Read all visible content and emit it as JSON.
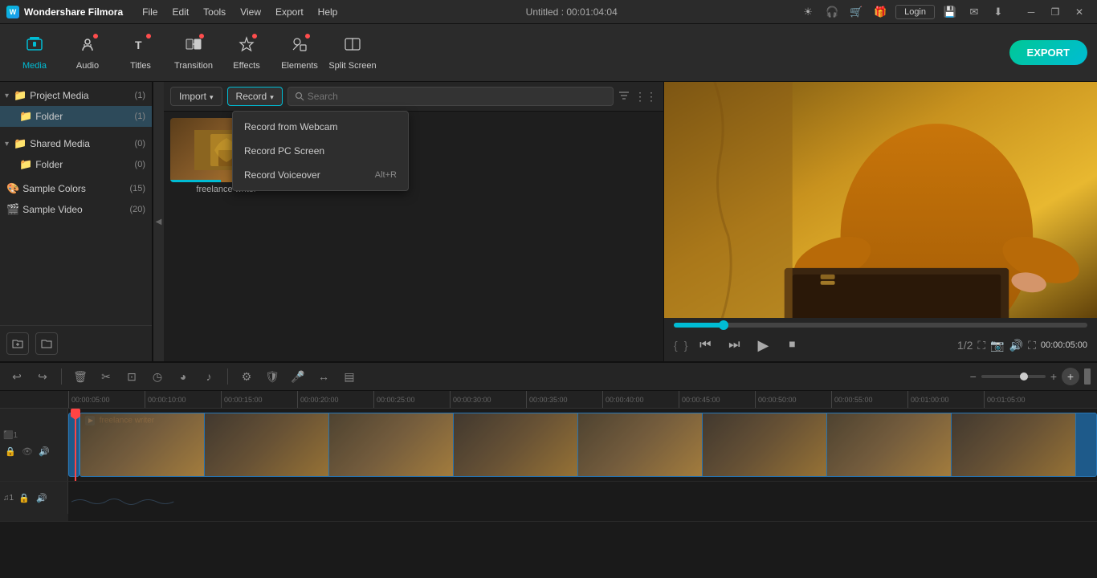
{
  "app": {
    "name": "Wondershare Filmora",
    "title": "Untitled : 00:01:04:04"
  },
  "menu": {
    "items": [
      "File",
      "Edit",
      "Tools",
      "View",
      "Export",
      "Help"
    ]
  },
  "toolbar": {
    "items": [
      {
        "id": "media",
        "label": "Media",
        "icon": "🎞",
        "active": true,
        "badge": false
      },
      {
        "id": "audio",
        "label": "Audio",
        "icon": "🎵",
        "active": false,
        "badge": true
      },
      {
        "id": "titles",
        "label": "Titles",
        "icon": "T",
        "active": false,
        "badge": true
      },
      {
        "id": "transition",
        "label": "Transition",
        "icon": "⧉",
        "active": false,
        "badge": true
      },
      {
        "id": "effects",
        "label": "Effects",
        "icon": "✦",
        "active": false,
        "badge": true
      },
      {
        "id": "elements",
        "label": "Elements",
        "icon": "◈",
        "active": false,
        "badge": true
      },
      {
        "id": "split_screen",
        "label": "Split Screen",
        "icon": "⊞",
        "active": false,
        "badge": false
      }
    ],
    "export_label": "EXPORT"
  },
  "sidebar": {
    "sections": [
      {
        "label": "Project Media",
        "count": "(1)",
        "expanded": true,
        "items": [
          {
            "label": "Folder",
            "count": "(1)",
            "active": true
          }
        ]
      },
      {
        "label": "Shared Media",
        "count": "(0)",
        "expanded": true,
        "items": [
          {
            "label": "Folder",
            "count": "(0)",
            "active": false
          }
        ]
      },
      {
        "label": "Sample Colors",
        "count": "(15)",
        "is_leaf": true
      },
      {
        "label": "Sample Video",
        "count": "(20)",
        "is_leaf": true
      }
    ]
  },
  "media_toolbar": {
    "import_label": "Import",
    "record_label": "Record",
    "search_placeholder": "Search"
  },
  "dropdown": {
    "visible": true,
    "items": [
      {
        "label": "Record from Webcam",
        "shortcut": ""
      },
      {
        "label": "Record PC Screen",
        "shortcut": ""
      },
      {
        "label": "Record Voiceover",
        "shortcut": "Alt+R"
      }
    ]
  },
  "media_items": [
    {
      "label": "freelance writer",
      "has_progress": true
    }
  ],
  "preview": {
    "time_current": "00:00:05:00",
    "ratio": "1/2",
    "brackets_open": "{",
    "brackets_close": "}"
  },
  "timeline": {
    "ruler_marks": [
      "00:00:05:00",
      "00:00:10:00",
      "00:00:15:00",
      "00:00:20:00",
      "00:00:25:00",
      "00:00:30:00",
      "00:00:35:00",
      "00:00:40:00",
      "00:00:45:00",
      "00:00:50:00",
      "00:00:55:00",
      "00:01:00:00",
      "00:01:05:00"
    ],
    "tracks": [
      {
        "num": "",
        "type": "video",
        "clip_label": "freelance writer"
      },
      {
        "num": "1",
        "type": "audio"
      }
    ]
  },
  "icons": {
    "undo": "↩",
    "redo": "↪",
    "delete": "🗑",
    "cut": "✂",
    "crop": "⊡",
    "speed": "◷",
    "color": "◕",
    "audio": "♪",
    "settings": "⚙",
    "shield": "🛡",
    "mic": "🎤",
    "motion": "↔",
    "caption": "▤",
    "zoom_out": "−",
    "zoom_in": "+",
    "settings2": "⚙",
    "lock": "🔒",
    "eye": "👁",
    "speaker": "🔊",
    "music": "♫"
  }
}
